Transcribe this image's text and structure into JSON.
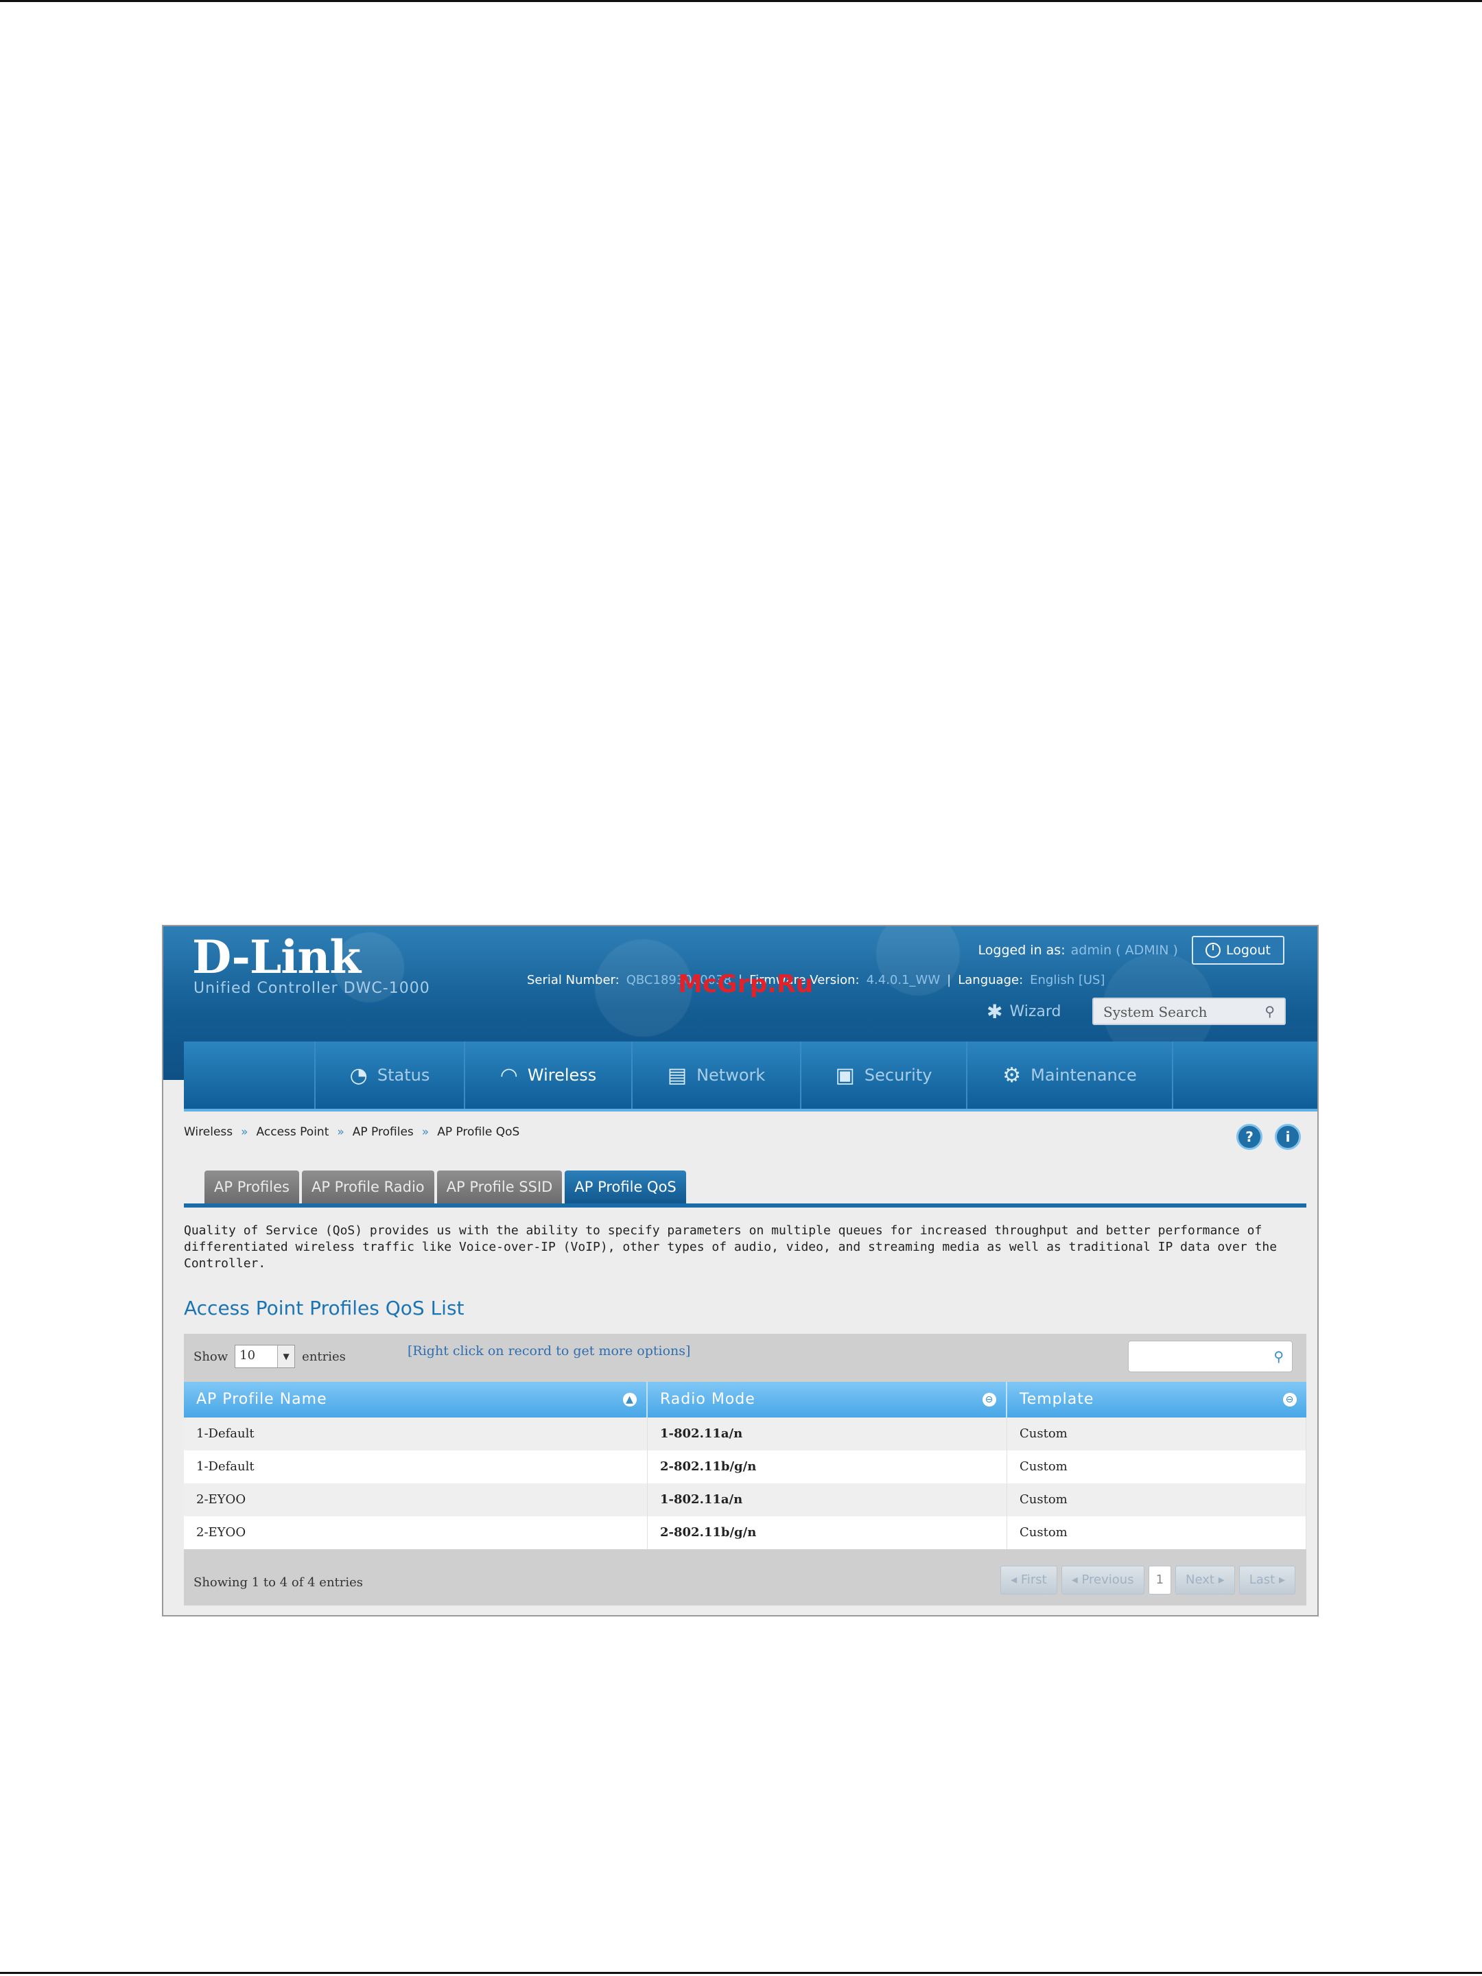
{
  "header": {
    "brand": "D-Link",
    "subtitle": "Unified Controller   DWC-1000",
    "logged_in_label": "Logged in as:",
    "logged_in_user": "admin ( ADMIN )",
    "logout_label": "Logout",
    "serial_label": "Serial Number:",
    "serial_value": "QBC1893000038",
    "firmware_label": "Firmware Version:",
    "firmware_value": "4.4.0.1_WW",
    "language_label": "Language:",
    "language_value": "English [US]",
    "wizard_label": "Wizard",
    "search_placeholder": "System Search",
    "watermark": "McGrp.Ru"
  },
  "nav": {
    "items": [
      {
        "label": "Status",
        "icon": "gauge-icon"
      },
      {
        "label": "Wireless",
        "icon": "wifi-icon"
      },
      {
        "label": "Network",
        "icon": "network-icon"
      },
      {
        "label": "Security",
        "icon": "lock-icon"
      },
      {
        "label": "Maintenance",
        "icon": "gears-icon"
      }
    ],
    "active": "Wireless"
  },
  "breadcrumb": [
    "Wireless",
    "Access Point",
    "AP Profiles",
    "AP Profile QoS"
  ],
  "breadcrumb_sep": "»",
  "tabs": [
    "AP Profiles",
    "AP Profile Radio",
    "AP Profile SSID",
    "AP Profile QoS"
  ],
  "active_tab": "AP Profile QoS",
  "description": "Quality of Service (QoS) provides us with the ability to specify parameters on multiple queues for increased throughput and better performance of differentiated wireless traffic like Voice-over-IP (VoIP), other types of audio, video, and streaming media as well as traditional IP data over the Controller.",
  "section_title": "Access Point Profiles QoS List",
  "grid": {
    "show_label": "Show",
    "entries_value": "10",
    "entries_label": "entries",
    "hint": "[Right click on record to get more options]",
    "columns": [
      "AP Profile Name",
      "Radio Mode",
      "Template"
    ],
    "rows": [
      [
        "1-Default",
        "1-802.11a/n",
        "Custom"
      ],
      [
        "1-Default",
        "2-802.11b/g/n",
        "Custom"
      ],
      [
        "2-EYOO",
        "1-802.11a/n",
        "Custom"
      ],
      [
        "2-EYOO",
        "2-802.11b/g/n",
        "Custom"
      ]
    ],
    "footer": "Showing 1 to 4 of 4 entries",
    "pager": {
      "first": "First",
      "previous": "Previous",
      "page": "1",
      "next": "Next",
      "last": "Last"
    }
  },
  "colors": {
    "header_blue": "#135d93",
    "accent": "#1b74b3",
    "table_header": "#48a6e6"
  }
}
